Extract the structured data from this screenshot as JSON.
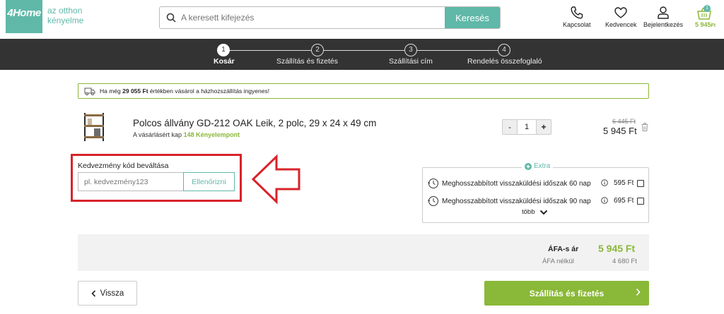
{
  "header": {
    "logo_text": "4Home",
    "tagline_line1": "az otthon",
    "tagline_line2": "kényelme",
    "search_placeholder": "A keresett kifejezés",
    "search_button": "Keresés",
    "contact_label": "Kapcsolat",
    "favorites_label": "Kedvencek",
    "login_label": "Bejelentkezés",
    "cart_count": "1",
    "cart_total": "5 945",
    "cart_currency": "Ft"
  },
  "steps": [
    {
      "number": "1",
      "label": "Kosár",
      "active": true
    },
    {
      "number": "2",
      "label": "Szállítás és fizetés",
      "active": false
    },
    {
      "number": "3",
      "label": "Szállítási cím",
      "active": false
    },
    {
      "number": "4",
      "label": "Rendelés összefoglaló",
      "active": false
    }
  ],
  "notice": {
    "prefix": "Ha még",
    "amount": "29 055 Ft",
    "suffix": "értékben vásárol a házhozszállítás ingyenes!"
  },
  "product": {
    "name": "Polcos állvány GD-212 OAK Leik, 2 polc, 29 x 24 x 49 cm",
    "points_prefix": "A vásárlásért kap",
    "points_value": "148 Kényelempont",
    "quantity": "1",
    "minus": "-",
    "plus": "+",
    "old_price": "6 445 Ft",
    "price": "5 945 Ft"
  },
  "coupon": {
    "title": "Kedvezmény kód beváltása",
    "placeholder": "pl. kedvezmény123",
    "button": "Ellenőrizni"
  },
  "extra": {
    "title": "Extra",
    "options": [
      {
        "label": "Meghosszabbított visszaküldési időszak 60 nap",
        "price": "595 Ft",
        "checked": false
      },
      {
        "label": "Meghosszabbított visszaküldési időszak 90 nap",
        "price": "695 Ft",
        "checked": false
      }
    ],
    "more": "több"
  },
  "totals": {
    "vat_label": "ÁFA-s ár",
    "vat_value": "5 945 Ft",
    "net_label": "ÁFA nélkül",
    "net_value": "4 680 Ft"
  },
  "nav": {
    "back": "Vissza",
    "next": "Szállítás és fizetés"
  },
  "colors": {
    "teal": "#5fb8a8",
    "green": "#8ab838",
    "dark_bar": "#333333",
    "highlight_red": "#d8232a"
  }
}
